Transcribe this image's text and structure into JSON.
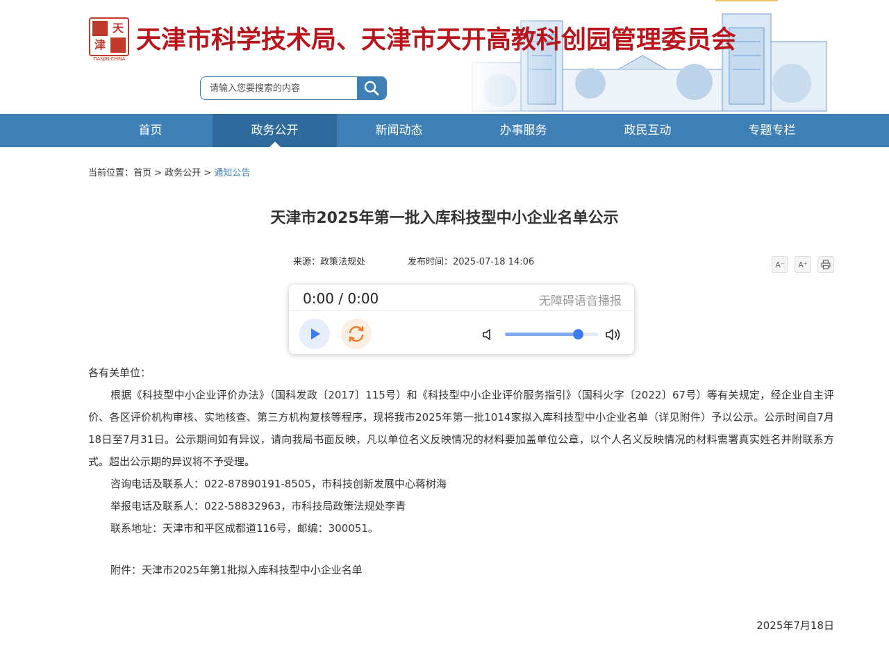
{
  "header": {
    "seal_text": "天津",
    "seal_caption": "TIANJIN·CHINA",
    "site_title": "天津市科学技术局、天津市天开高教科创园管理委员会",
    "search_placeholder": "请输入您要搜索的内容"
  },
  "nav": {
    "items": [
      {
        "label": "首页",
        "active": false
      },
      {
        "label": "政务公开",
        "active": true
      },
      {
        "label": "新闻动态",
        "active": false
      },
      {
        "label": "办事服务",
        "active": false
      },
      {
        "label": "政民互动",
        "active": false
      },
      {
        "label": "专题专栏",
        "active": false
      }
    ]
  },
  "breadcrumb": {
    "prefix": "当前位置：",
    "home": "首页",
    "sep": " > ",
    "section": "政务公开",
    "current": "通知公告"
  },
  "article": {
    "title": "天津市2025年第一批入库科技型中小企业名单公示",
    "source": "来源：政策法规处",
    "publish_time": "发布时间：2025-07-18 14:06",
    "salutation": "各有关单位：",
    "paragraph": "根据《科技型中小企业评价办法》（国科发政〔2017〕115号）和《科技型中小企业评价服务指引》（国科火字〔2022〕67号）等有关规定，经企业自主评价、各区评价机构审核、实地核查、第三方机构复核等程序，现将我市2025年第一批1014家拟入库科技型中小企业名单（详见附件）予以公示。公示时间自7月18日至7月31日。公示期间如有异议，请向我局书面反映，凡以单位名义反映情况的材料要加盖单位公章，以个人名义反映情况的材料需署真实姓名并附联系方式。超出公示期的异议将不予受理。",
    "consult": "咨询电话及联系人：022-87890191-8505，市科技创新发展中心蒋树海",
    "report": "举报电话及联系人：022-58832963，市科技局政策法规处李青",
    "address": "联系地址：天津市和平区成都道116号，邮编：300051。",
    "attachment": "附件：天津市2025年第1批拟入库科技型中小企业名单",
    "date": "2025年7月18日"
  },
  "tools": {
    "font_decrease": "A⁻",
    "font_increase": "A⁺",
    "print_icon": "printer-icon"
  },
  "player": {
    "time": "0:00 / 0:00",
    "label": "无障碍语音播报",
    "volume": 0.78
  },
  "colors": {
    "brand_red": "#b8151c",
    "nav_blue": "#3e80b5",
    "nav_active": "#2e6a9b"
  }
}
